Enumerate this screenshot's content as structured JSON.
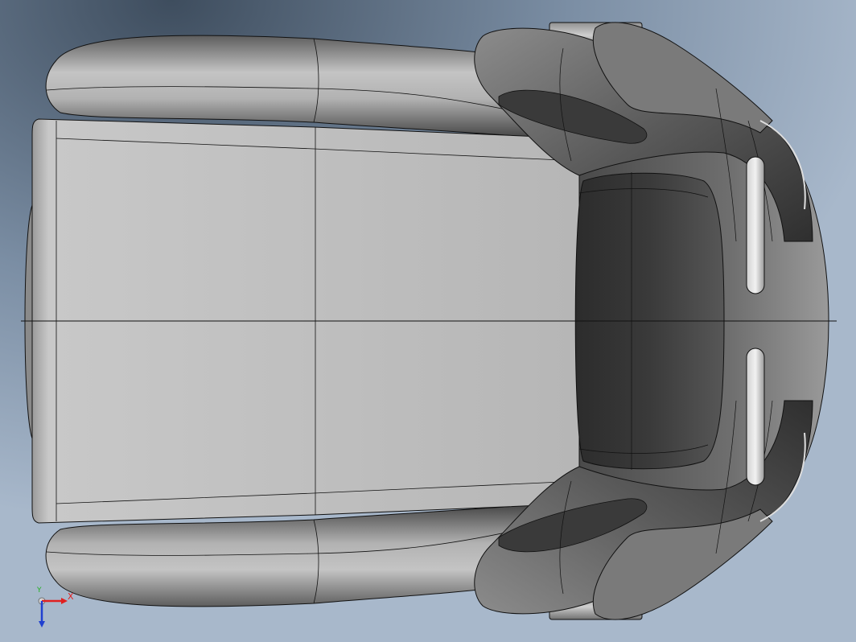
{
  "viewport": {
    "background_top": "#3e4d5e",
    "background_bottom": "#a8b8cb"
  },
  "model": {
    "name": "racing-seat",
    "view": "top",
    "display_mode": "shaded-with-edges",
    "edge_color": "#111111"
  },
  "triad": {
    "x_label": "X",
    "y_label": "Y",
    "x_color": "#e02020",
    "y_color": "#20b020",
    "z_color": "#2040d0"
  }
}
